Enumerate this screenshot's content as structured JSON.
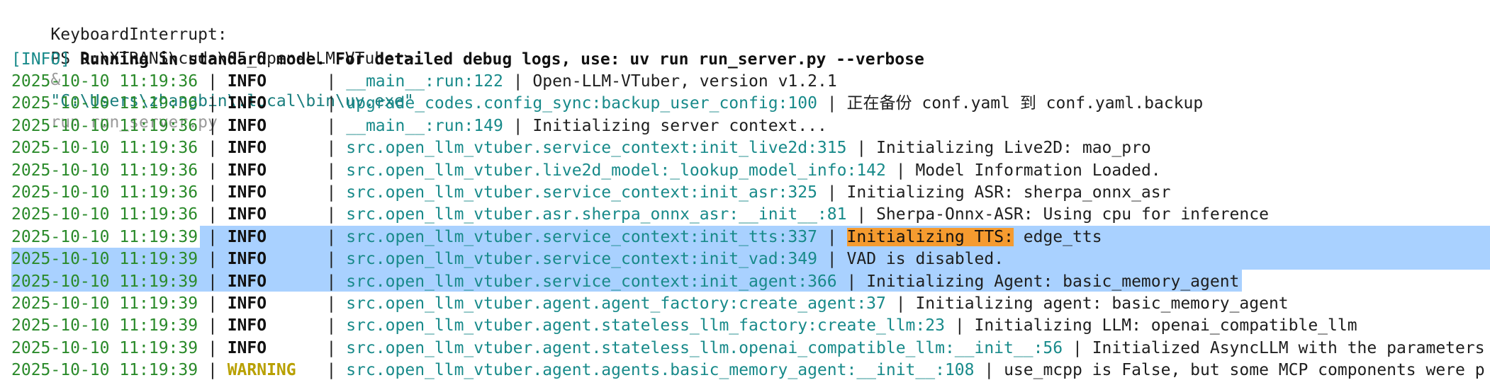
{
  "terminal": {
    "line_interrupt": "KeyboardInterrupt:",
    "prompt": {
      "path": "PS D:\\XTRANS\\cuda\\05_Open-LLM-VTuber>",
      "amp": "&",
      "exe": "\"C:\\Users\\zhangbin\\.local\\bin\\uv.exe\"",
      "args": "run run_server.py"
    },
    "info_banner": {
      "tag": "[INFO]",
      "text": "Running in standard mode. For detailed debug logs, use: uv run run_server.py --verbose"
    },
    "sep": "|",
    "logs": [
      {
        "ts": "2025-10-10 11:19:36",
        "level": "INFO",
        "module": "__main__:run:122",
        "msg": "Open-LLM-VTuber, version v1.2.1"
      },
      {
        "ts": "2025-10-10 11:19:36",
        "level": "INFO",
        "module": "upgrade_codes.config_sync:backup_user_config:100",
        "msg": "正在备份 conf.yaml 到 conf.yaml.backup"
      },
      {
        "ts": "2025-10-10 11:19:36",
        "level": "INFO",
        "module": "__main__:run:149",
        "msg": "Initializing server context..."
      },
      {
        "ts": "2025-10-10 11:19:36",
        "level": "INFO",
        "module": "src.open_llm_vtuber.service_context:init_live2d:315",
        "msg": "Initializing Live2D: mao_pro"
      },
      {
        "ts": "2025-10-10 11:19:36",
        "level": "INFO",
        "module": "src.open_llm_vtuber.live2d_model:_lookup_model_info:142",
        "msg": "Model Information Loaded."
      },
      {
        "ts": "2025-10-10 11:19:36",
        "level": "INFO",
        "module": "src.open_llm_vtuber.service_context:init_asr:325",
        "msg": "Initializing ASR: sherpa_onnx_asr"
      },
      {
        "ts": "2025-10-10 11:19:36",
        "level": "INFO",
        "module": "src.open_llm_vtuber.asr.sherpa_onnx_asr:__init__:81",
        "msg": "Sherpa-Onnx-ASR: Using cpu for inference"
      },
      {
        "ts": "2025-10-10 11:19:39",
        "level": "INFO",
        "module": "src.open_llm_vtuber.service_context:init_tts:337",
        "msg_highlight": "Initializing TTS:",
        "msg": " edge_tts"
      },
      {
        "ts": "2025-10-10 11:19:39",
        "level": "INFO",
        "module": "src.open_llm_vtuber.service_context:init_vad:349",
        "msg": "VAD is disabled."
      },
      {
        "ts": "2025-10-10 11:19:39",
        "level": "INFO",
        "module": "src.open_llm_vtuber.service_context:init_agent:366",
        "msg": "Initializing Agent: basic_memory_agent"
      },
      {
        "ts": "2025-10-10 11:19:39",
        "level": "INFO",
        "module": "src.open_llm_vtuber.agent.agent_factory:create_agent:37",
        "msg": "Initializing agent: basic_memory_agent"
      },
      {
        "ts": "2025-10-10 11:19:39",
        "level": "INFO",
        "module": "src.open_llm_vtuber.agent.stateless_llm_factory:create_llm:23",
        "msg": "Initializing LLM: openai_compatible_llm"
      },
      {
        "ts": "2025-10-10 11:19:39",
        "level": "INFO",
        "module": "src.open_llm_vtuber.agent.stateless_llm.openai_compatible_llm:__init__:56",
        "msg": "Initialized AsyncLLM with the parameters"
      },
      {
        "ts": "2025-10-10 11:19:39",
        "level": "WARNING",
        "module": "src.open_llm_vtuber.agent.agents.basic_memory_agent:__init__:108",
        "msg": "use_mcpp is False, but some MCP components were p"
      }
    ]
  },
  "colors": {
    "timestamp": "#2a8a2a",
    "module": "#188a8a",
    "warning": "#b8a000",
    "selection": "#a9d1ff",
    "highlight": "#f59b2f"
  }
}
